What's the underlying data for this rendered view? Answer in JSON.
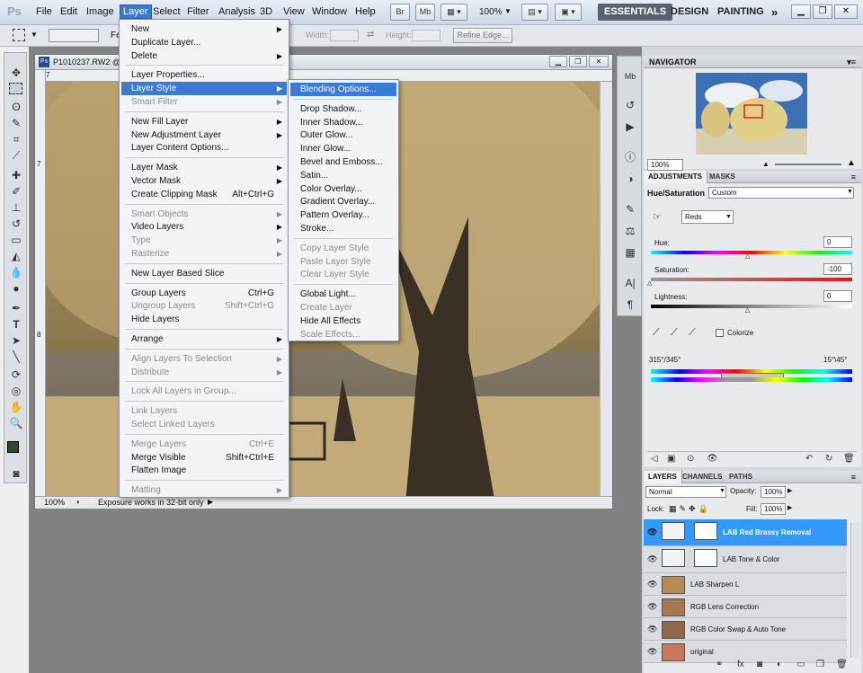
{
  "app": {
    "logo": "Ps"
  },
  "menubar": {
    "items": [
      "File",
      "Edit",
      "Image",
      "Layer",
      "Select",
      "Filter",
      "Analysis",
      "3D",
      "View",
      "Window",
      "Help"
    ],
    "zoom": "100%",
    "mini_bridge": "Br",
    "mini_mb": "Mb",
    "workspaces": [
      "ESSENTIALS",
      "DESIGN",
      "PAINTING"
    ],
    "more": "»"
  },
  "options": {
    "width_label": "Width:",
    "height_label": "Height:",
    "refine_edge": "Refine Edge...",
    "feather_label": "Fe"
  },
  "document": {
    "title": "P1010237.RW2 @",
    "zoom": "100%",
    "status": "Exposure works in 32-bit only",
    "ruler_top": [
      "7",
      "8"
    ],
    "ruler_left": [
      "7",
      "8"
    ]
  },
  "layer_menu": {
    "items": [
      {
        "label": "New",
        "arrow": true
      },
      {
        "label": "Duplicate Layer..."
      },
      {
        "label": "Delete",
        "arrow": true
      },
      {
        "sep": true
      },
      {
        "label": "Layer Properties..."
      },
      {
        "label": "Layer Style",
        "arrow": true,
        "highlight": true
      },
      {
        "label": "Smart Filter",
        "arrow": true,
        "disabled": true
      },
      {
        "sep": true
      },
      {
        "label": "New Fill Layer",
        "arrow": true
      },
      {
        "label": "New Adjustment Layer",
        "arrow": true
      },
      {
        "label": "Layer Content Options..."
      },
      {
        "sep": true
      },
      {
        "label": "Layer Mask",
        "arrow": true
      },
      {
        "label": "Vector Mask",
        "arrow": true
      },
      {
        "label": "Create Clipping Mask",
        "shortcut": "Alt+Ctrl+G"
      },
      {
        "sep": true
      },
      {
        "label": "Smart Objects",
        "arrow": true,
        "disabled": true
      },
      {
        "label": "Video Layers",
        "arrow": true
      },
      {
        "label": "Type",
        "arrow": true,
        "disabled": true
      },
      {
        "label": "Rasterize",
        "arrow": true,
        "disabled": true
      },
      {
        "sep": true
      },
      {
        "label": "New Layer Based Slice"
      },
      {
        "sep": true
      },
      {
        "label": "Group Layers",
        "shortcut": "Ctrl+G"
      },
      {
        "label": "Ungroup Layers",
        "shortcut": "Shift+Ctrl+G",
        "disabled": true
      },
      {
        "label": "Hide Layers"
      },
      {
        "sep": true
      },
      {
        "label": "Arrange",
        "arrow": true
      },
      {
        "sep": true
      },
      {
        "label": "Align Layers To Selection",
        "arrow": true,
        "disabled": true
      },
      {
        "label": "Distribute",
        "arrow": true,
        "disabled": true
      },
      {
        "sep": true
      },
      {
        "label": "Lock All Layers in Group...",
        "disabled": true
      },
      {
        "sep": true
      },
      {
        "label": "Link Layers",
        "disabled": true
      },
      {
        "label": "Select Linked Layers",
        "disabled": true
      },
      {
        "sep": true
      },
      {
        "label": "Merge Layers",
        "shortcut": "Ctrl+E",
        "disabled": true
      },
      {
        "label": "Merge Visible",
        "shortcut": "Shift+Ctrl+E"
      },
      {
        "label": "Flatten Image"
      },
      {
        "sep": true
      },
      {
        "label": "Matting",
        "arrow": true,
        "disabled": true
      }
    ]
  },
  "style_menu": {
    "items": [
      {
        "label": "Blending Options...",
        "highlight": true
      },
      {
        "sep": true
      },
      {
        "label": "Drop Shadow..."
      },
      {
        "label": "Inner Shadow..."
      },
      {
        "label": "Outer Glow..."
      },
      {
        "label": "Inner Glow..."
      },
      {
        "label": "Bevel and Emboss..."
      },
      {
        "label": "Satin..."
      },
      {
        "label": "Color Overlay..."
      },
      {
        "label": "Gradient Overlay..."
      },
      {
        "label": "Pattern Overlay..."
      },
      {
        "label": "Stroke..."
      },
      {
        "sep": true
      },
      {
        "label": "Copy Layer Style",
        "disabled": true
      },
      {
        "label": "Paste Layer Style",
        "disabled": true
      },
      {
        "label": "Clear Layer Style",
        "disabled": true
      },
      {
        "sep": true
      },
      {
        "label": "Global Light..."
      },
      {
        "label": "Create Layer",
        "disabled": true
      },
      {
        "label": "Hide All Effects"
      },
      {
        "label": "Scale Effects...",
        "disabled": true
      }
    ]
  },
  "navigator": {
    "title": "NAVIGATOR",
    "zoom": "100%"
  },
  "adjustments": {
    "tabs": [
      "ADJUSTMENTS",
      "MASKS"
    ],
    "type": "Hue/Saturation",
    "preset": "Custom",
    "channel": "Reds",
    "hue_label": "Hue:",
    "hue": "0",
    "hue_level": 0.5,
    "saturation_label": "Saturation:",
    "saturation": "-100",
    "saturation_level": 0.0,
    "lightness_label": "Lightness:",
    "lightness": "0",
    "lightness_level": 0.5,
    "colorize": "Colorize",
    "range_left": "315°/345°",
    "range_right": "15°\\45°"
  },
  "layers": {
    "tabs": [
      "LAYERS",
      "CHANNELS",
      "PATHS"
    ],
    "blend_mode": "Normal",
    "opacity_label": "Opacity:",
    "opacity": "100%",
    "lock_label": "Lock:",
    "fill_label": "Fill:",
    "fill": "100%",
    "rows": [
      {
        "name": "LAB Red Brassy Removal",
        "selected": true,
        "adjust": true
      },
      {
        "name": "LAB Tone & Color",
        "adjust": true
      },
      {
        "name": "LAB Sharpen L"
      },
      {
        "name": "RGB Lens Correction"
      },
      {
        "name": "RGB Color Swap & Auto Tone"
      },
      {
        "name": "original"
      }
    ]
  },
  "colors": {
    "accent": "#3a7bd5",
    "layer_selected": "#3399ff",
    "canvas_bg": "#828282"
  }
}
